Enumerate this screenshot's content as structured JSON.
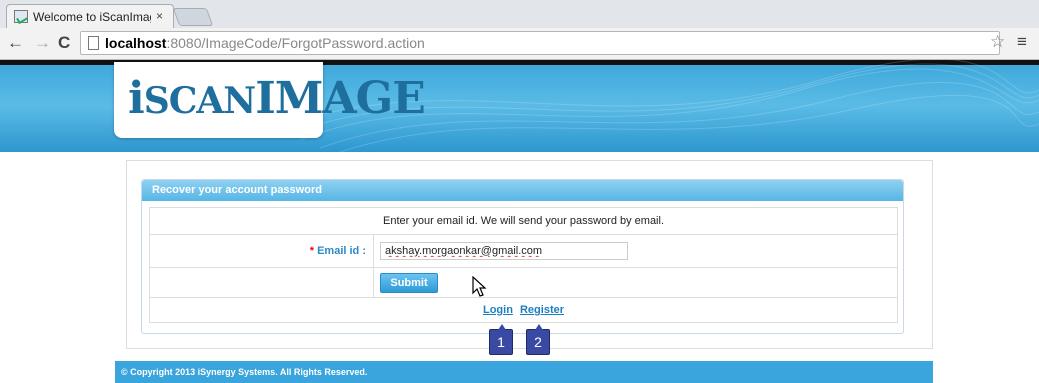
{
  "browser": {
    "tab_title": "Welcome to iScanImag",
    "tab_close": "×",
    "back": "←",
    "forward": "→",
    "reload": "C",
    "url_host": "localhost",
    "url_rest": ":8080/ImageCode/ForgotPassword.action",
    "star": "☆",
    "menu": "≡"
  },
  "logo": {
    "first": "i",
    "second": "SCAN",
    "third": "IMAGE"
  },
  "panel": {
    "title": "Recover your account password",
    "instructions": "Enter your email id. We will send your password by email.",
    "email_required_mark": "*",
    "email_label": " Email id :",
    "email_value": "akshay.morgaonkar@gmail.com",
    "submit_label": "Submit",
    "login_link": "Login",
    "register_link": "Register"
  },
  "annotations": {
    "badge1": "1",
    "badge2": "2"
  },
  "footer": {
    "text": "© Copyright 2013 iSynergy Systems. All Rights Reserved."
  },
  "colors": {
    "brand_blue": "#3aa5dc",
    "link_blue": "#1b7fc2",
    "badge": "#3a4aa3",
    "required": "#e02"
  }
}
